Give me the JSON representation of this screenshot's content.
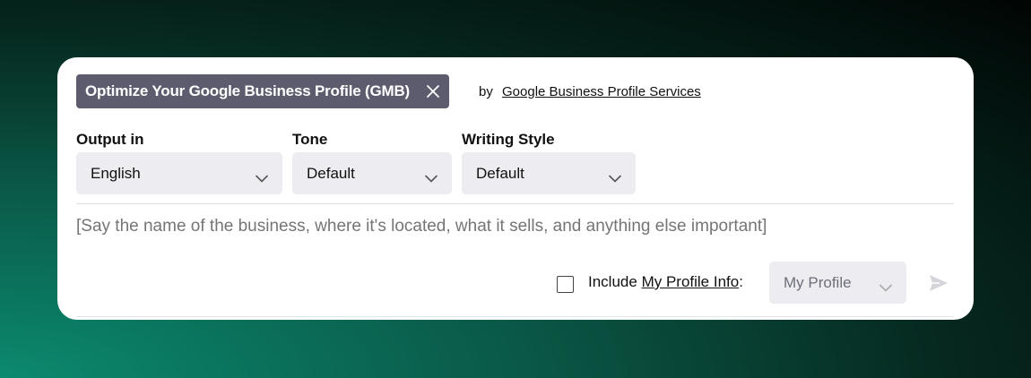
{
  "template": {
    "title": "Optimize Your Google Business Profile (GMB)",
    "by_label": "by",
    "author": "Google Business Profile Services"
  },
  "fields": [
    {
      "label": "Output in",
      "value": "English"
    },
    {
      "label": "Tone",
      "value": "Default"
    },
    {
      "label": "Writing Style",
      "value": "Default"
    }
  ],
  "prompt": {
    "placeholder": "[Say the name of the business, where it's located, what it sells, and anything else important]"
  },
  "profile": {
    "include_label": "Include",
    "link_label": "My Profile Info",
    "colon": ":",
    "select_value": "My Profile",
    "checked": false
  },
  "icons": {
    "close": "close-icon",
    "chevron": "chevron-down-icon",
    "send": "send-icon"
  }
}
